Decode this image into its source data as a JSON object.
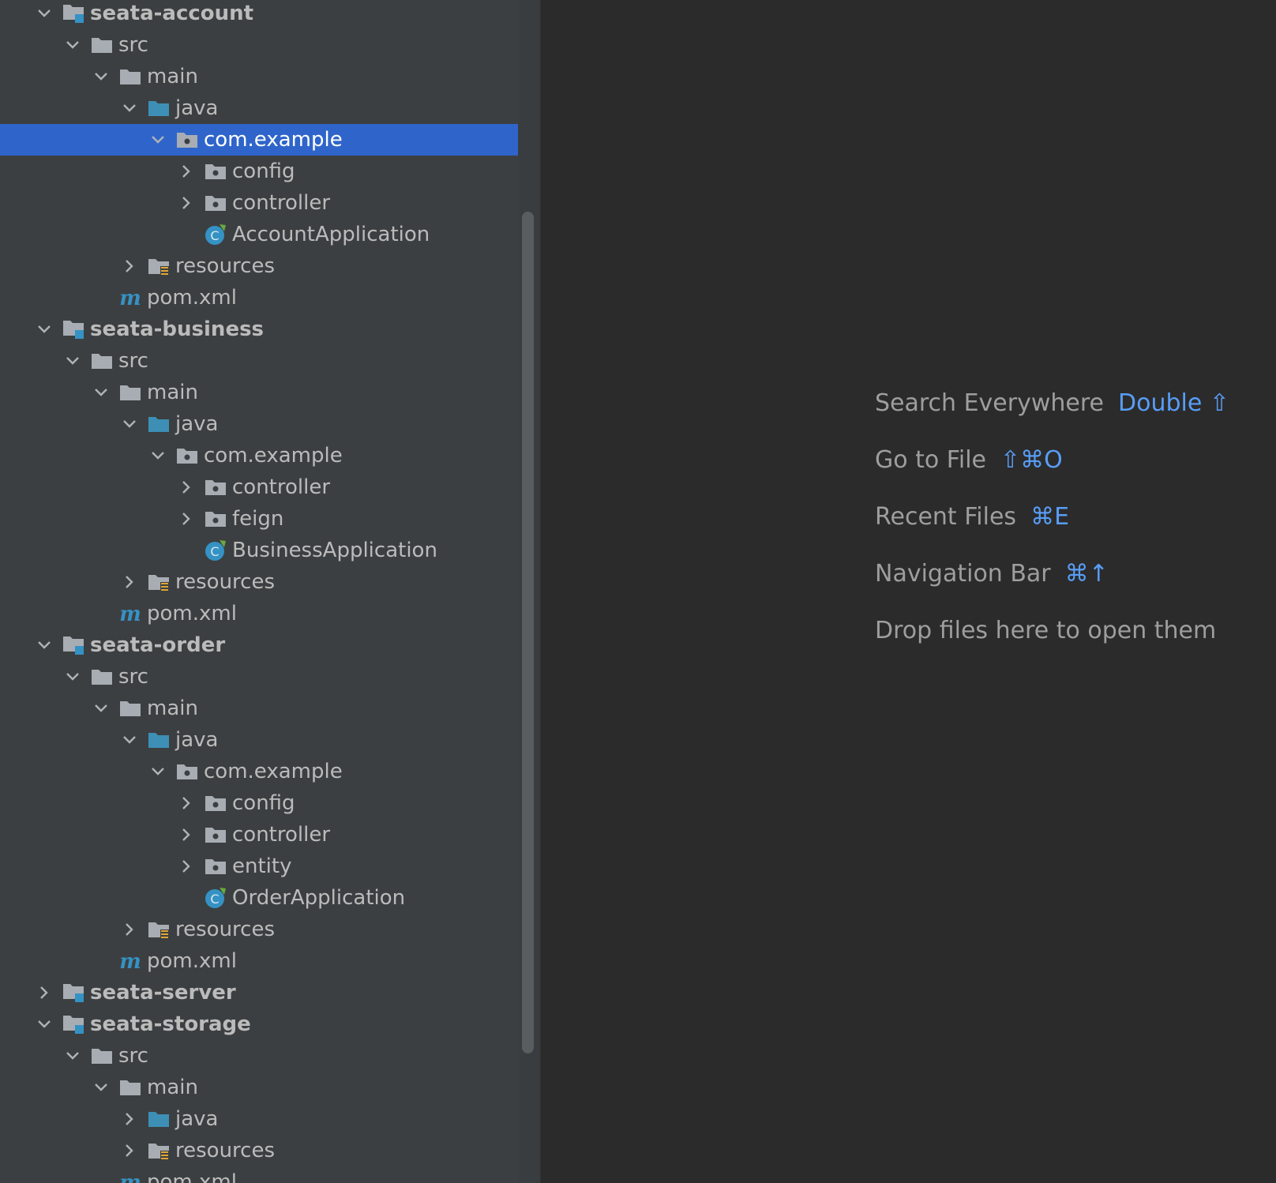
{
  "colors": {
    "panel_bg": "#3c3f41",
    "editor_bg": "#2b2b2b",
    "selection": "#2f65ca",
    "tree_text": "#bbbbbb",
    "hint_text": "#9e9e9e",
    "shortcut_text": "#589df6"
  },
  "project_tree": {
    "items": [
      {
        "label": "seata-account",
        "arrow": "expanded",
        "icon": "module-folder-icon",
        "bold": true
      },
      {
        "label": "src",
        "arrow": "expanded",
        "icon": "folder-icon"
      },
      {
        "label": "main",
        "arrow": "expanded",
        "icon": "folder-icon"
      },
      {
        "label": "java",
        "arrow": "expanded",
        "icon": "source-root-folder-icon"
      },
      {
        "label": "com.example",
        "arrow": "expanded",
        "icon": "package-folder-icon",
        "selected": true
      },
      {
        "label": "config",
        "arrow": "collapsed",
        "icon": "package-folder-icon"
      },
      {
        "label": "controller",
        "arrow": "collapsed",
        "icon": "package-folder-icon"
      },
      {
        "label": "AccountApplication",
        "arrow": "none",
        "icon": "spring-class-icon"
      },
      {
        "label": "resources",
        "arrow": "collapsed",
        "icon": "resources-folder-icon"
      },
      {
        "label": "pom.xml",
        "arrow": "none",
        "icon": "maven-file-icon"
      },
      {
        "label": "seata-business",
        "arrow": "expanded",
        "icon": "module-folder-icon",
        "bold": true
      },
      {
        "label": "src",
        "arrow": "expanded",
        "icon": "folder-icon"
      },
      {
        "label": "main",
        "arrow": "expanded",
        "icon": "folder-icon"
      },
      {
        "label": "java",
        "arrow": "expanded",
        "icon": "source-root-folder-icon"
      },
      {
        "label": "com.example",
        "arrow": "expanded",
        "icon": "package-folder-icon"
      },
      {
        "label": "controller",
        "arrow": "collapsed",
        "icon": "package-folder-icon"
      },
      {
        "label": "feign",
        "arrow": "collapsed",
        "icon": "package-folder-icon"
      },
      {
        "label": "BusinessApplication",
        "arrow": "none",
        "icon": "spring-class-icon"
      },
      {
        "label": "resources",
        "arrow": "collapsed",
        "icon": "resources-folder-icon"
      },
      {
        "label": "pom.xml",
        "arrow": "none",
        "icon": "maven-file-icon"
      },
      {
        "label": "seata-order",
        "arrow": "expanded",
        "icon": "module-folder-icon",
        "bold": true
      },
      {
        "label": "src",
        "arrow": "expanded",
        "icon": "folder-icon"
      },
      {
        "label": "main",
        "arrow": "expanded",
        "icon": "folder-icon"
      },
      {
        "label": "java",
        "arrow": "expanded",
        "icon": "source-root-folder-icon"
      },
      {
        "label": "com.example",
        "arrow": "expanded",
        "icon": "package-folder-icon"
      },
      {
        "label": "config",
        "arrow": "collapsed",
        "icon": "package-folder-icon"
      },
      {
        "label": "controller",
        "arrow": "collapsed",
        "icon": "package-folder-icon"
      },
      {
        "label": "entity",
        "arrow": "collapsed",
        "icon": "package-folder-icon"
      },
      {
        "label": "OrderApplication",
        "arrow": "none",
        "icon": "spring-class-icon"
      },
      {
        "label": "resources",
        "arrow": "collapsed",
        "icon": "resources-folder-icon"
      },
      {
        "label": "pom.xml",
        "arrow": "none",
        "icon": "maven-file-icon"
      },
      {
        "label": "seata-server",
        "arrow": "collapsed",
        "icon": "module-folder-icon",
        "bold": true
      },
      {
        "label": "seata-storage",
        "arrow": "expanded",
        "icon": "module-folder-icon",
        "bold": true
      },
      {
        "label": "src",
        "arrow": "expanded",
        "icon": "folder-icon"
      },
      {
        "label": "main",
        "arrow": "expanded",
        "icon": "folder-icon"
      },
      {
        "label": "java",
        "arrow": "collapsed",
        "icon": "source-root-folder-icon"
      },
      {
        "label": "resources",
        "arrow": "collapsed",
        "icon": "resources-folder-icon"
      },
      {
        "label": "pom.xml",
        "arrow": "none",
        "icon": "maven-file-icon"
      }
    ]
  },
  "editor_hints": {
    "search_everywhere": {
      "label": "Search Everywhere",
      "shortcut": "Double ⇧"
    },
    "go_to_file": {
      "label": "Go to File",
      "shortcut": "⇧⌘O"
    },
    "recent_files": {
      "label": "Recent Files",
      "shortcut": "⌘E"
    },
    "navigation_bar": {
      "label": "Navigation Bar",
      "shortcut": "⌘↑"
    },
    "drop_files": {
      "label": "Drop files here to open them"
    }
  }
}
